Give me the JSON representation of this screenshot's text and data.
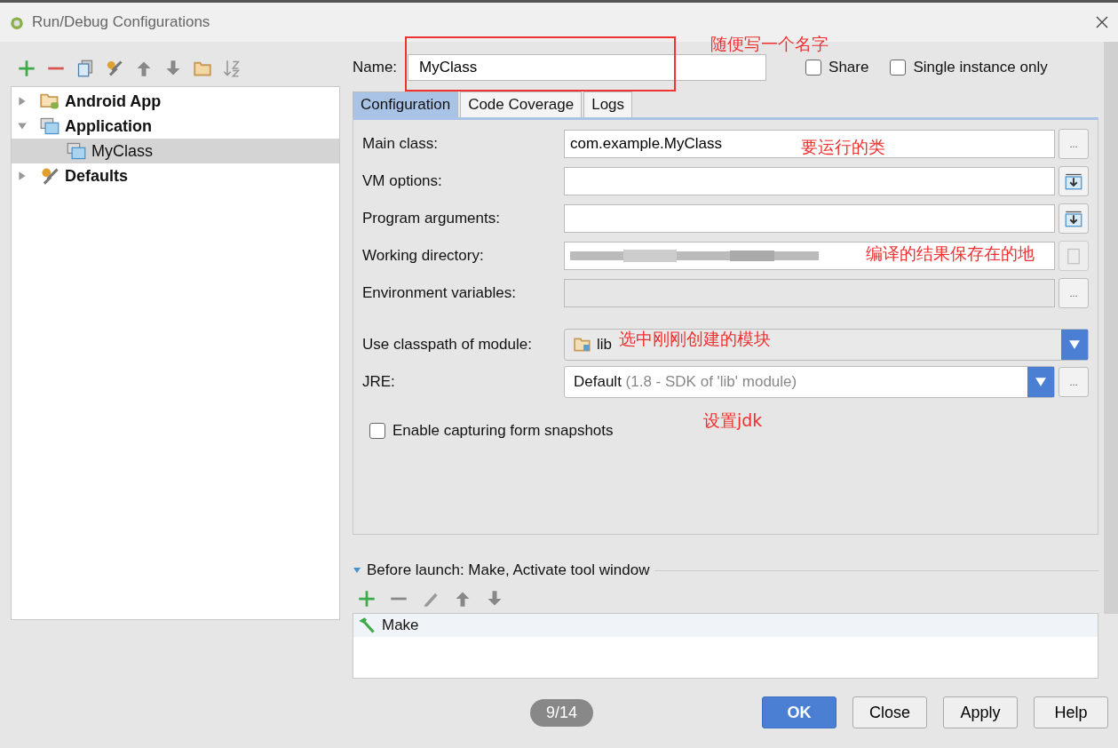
{
  "window": {
    "title": "Run/Debug Configurations"
  },
  "tree": [
    {
      "label": "Android App",
      "kind": "android",
      "expanded": false,
      "selected": false
    },
    {
      "label": "Application",
      "kind": "application",
      "expanded": true,
      "selected": false,
      "children": [
        {
          "label": "MyClass",
          "kind": "class",
          "selected": true
        }
      ]
    },
    {
      "label": "Defaults",
      "kind": "defaults",
      "expanded": false,
      "selected": false
    }
  ],
  "name": {
    "label": "Name:",
    "value": "MyClass"
  },
  "share": {
    "label": "Share",
    "checked": false
  },
  "single_instance": {
    "label": "Single instance only",
    "checked": false
  },
  "tabs": [
    {
      "label": "Configuration",
      "selected": true
    },
    {
      "label": "Code Coverage",
      "selected": false
    },
    {
      "label": "Logs",
      "selected": false
    }
  ],
  "fields": [
    {
      "label": "Main class:",
      "kind": "text",
      "value": "com.example.MyClass",
      "button": "..."
    },
    {
      "label": "VM options:",
      "kind": "expand"
    },
    {
      "label": "Program arguments:",
      "kind": "expand"
    },
    {
      "label": "Working directory:",
      "kind": "redacted"
    },
    {
      "label": "Environment variables:",
      "kind": "disabled",
      "button": "..."
    },
    {
      "label": "Use classpath of module:",
      "kind": "module",
      "value": "lib"
    },
    {
      "label": "JRE:",
      "kind": "jre",
      "value": "Default",
      "hint": "(1.8 - SDK of 'lib' module)",
      "button": "..."
    }
  ],
  "snapshots": {
    "label": "Enable capturing form snapshots",
    "checked": false
  },
  "before_launch": {
    "title": "Before launch: Make, Activate tool window",
    "expanded": true,
    "items": [
      {
        "label": "Make"
      }
    ]
  },
  "page_counter": "9/14",
  "buttons": [
    {
      "label": "OK",
      "default": true
    },
    {
      "label": "Close",
      "default": false
    },
    {
      "label": "Apply",
      "default": false
    },
    {
      "label": "Help",
      "default": false
    }
  ],
  "annotations": [
    {
      "text": "随便写一个名字",
      "kind": "name"
    },
    {
      "text": "要运行的类",
      "kind": "main"
    },
    {
      "text": "编译的结果保存在的地",
      "kind": "dir"
    },
    {
      "text": "选中刚刚创建的模块",
      "kind": "module"
    },
    {
      "text": "设置jdk",
      "kind": "jre"
    }
  ]
}
